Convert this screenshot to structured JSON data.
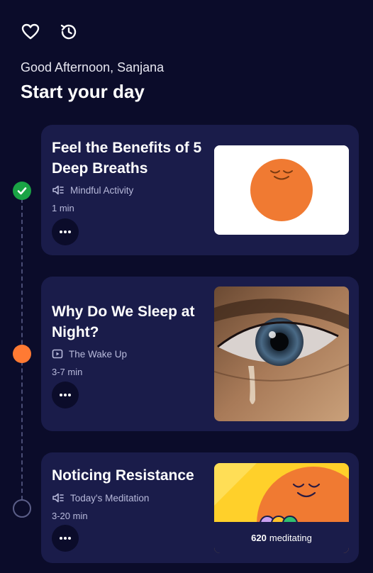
{
  "header": {
    "greeting": "Good Afternoon, Sanjana",
    "headline": "Start your day",
    "icons": [
      "heart-icon",
      "history-icon"
    ]
  },
  "cards": [
    {
      "title": "Feel the Benefits of 5 Deep Breaths",
      "type_icon": "audio-icon",
      "category": "Mindful Activity",
      "duration": "1 min",
      "status": "done"
    },
    {
      "title": "Why Do We Sleep at Night?",
      "type_icon": "video-icon",
      "category": "The Wake Up",
      "duration": "3-7 min",
      "status": "current"
    },
    {
      "title": "Noticing Resistance",
      "type_icon": "audio-icon",
      "category": "Today's Meditation",
      "duration": "3-20 min",
      "status": "todo",
      "meditating_count": "620",
      "meditating_label": "meditating"
    }
  ],
  "colors": {
    "background": "#0b0c2a",
    "card": "#1a1c4a",
    "accent_orange": "#ff7a33",
    "done_green": "#1aa345",
    "muted_text": "#b8badb"
  }
}
